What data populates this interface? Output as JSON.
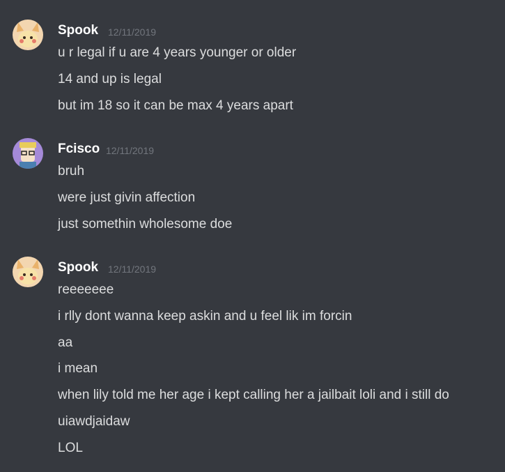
{
  "colors": {
    "background": "#36393f",
    "username": "#ffffff",
    "timestamp": "#72767d",
    "text": "#dcddde"
  },
  "messages": [
    {
      "author": "Spook",
      "timestamp": "12/11/2019",
      "avatar": "spook-avatar-icon",
      "lines": [
        "u r legal if u are 4 years younger or older",
        "14 and up is legal",
        "but im 18 so it can be max 4 years apart"
      ]
    },
    {
      "author": "Fcisco",
      "timestamp": "12/11/2019",
      "avatar": "fcisco-avatar-icon",
      "lines": [
        "bruh",
        "were just givin affection",
        "just somethin wholesome doe"
      ]
    },
    {
      "author": "Spook",
      "timestamp": "12/11/2019",
      "avatar": "spook-avatar-icon",
      "lines": [
        "reeeeeee",
        "i rlly dont wanna keep askin and u feel lik im forcin",
        "aa",
        "i mean",
        "when lily told me her age i kept calling her a jailbait loli and i still do",
        "uiawdjaidaw",
        "LOL"
      ]
    }
  ]
}
